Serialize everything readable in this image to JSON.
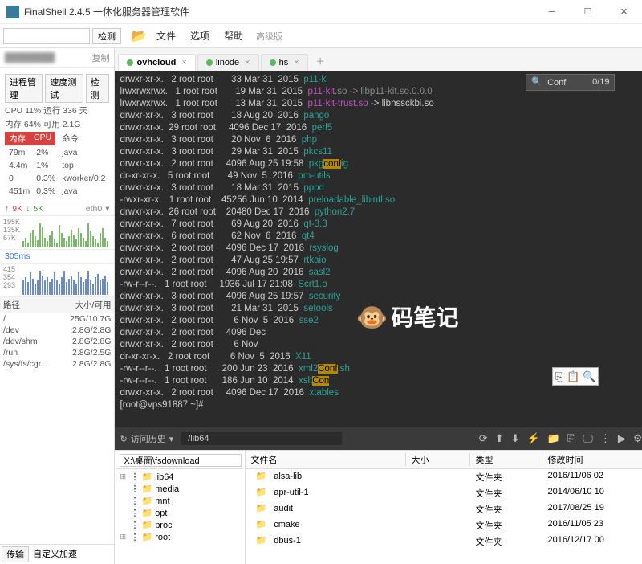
{
  "title": "FinalShell 2.4.5 一体化服务器管理软件",
  "topbar": {
    "search_placeholder": "",
    "detect": "检测",
    "menu_file": "文件",
    "menu_option": "选项",
    "menu_help": "帮助",
    "adv": "高级版"
  },
  "tabs": [
    {
      "name": "ovhcloud"
    },
    {
      "name": "linode"
    },
    {
      "name": "hs"
    }
  ],
  "sidebar": {
    "copy": "复制",
    "tabs": [
      "进程管理",
      "速度测试",
      "检测"
    ],
    "cpu_line": "CPU 11% 运行 336 天",
    "mem_line": "内存 64% 可用 2.1G",
    "col_mem": "内存",
    "col_cpu": "CPU",
    "col_cmd": "命令",
    "procs": [
      [
        "79m",
        "2%",
        "java"
      ],
      [
        "4.4m",
        "1%",
        "top"
      ],
      [
        "0",
        "0.3%",
        "kworker/0:2"
      ],
      [
        "451m",
        "0.3%",
        "java"
      ]
    ],
    "net_up": "9K",
    "net_down": "5K",
    "net_if": "eth0",
    "chart1_labels": [
      "195K",
      "135K",
      "67K"
    ],
    "ping": "305ms",
    "chart2_labels": [
      "415",
      "354",
      "293"
    ],
    "path_head": [
      "路径",
      "大小/可用"
    ],
    "paths": [
      [
        "/",
        "25G/10.7G"
      ],
      [
        "/dev",
        "2.8G/2.8G"
      ],
      [
        "/dev/shm",
        "2.8G/2.8G"
      ],
      [
        "/run",
        "2.8G/2.5G"
      ],
      [
        "/sys/fs/cgr...",
        "2.8G/2.8G"
      ]
    ],
    "bottom_tabs": [
      "传输",
      "自定义加速"
    ]
  },
  "find": {
    "text": "Conf",
    "count": "0/19"
  },
  "term_lines": [
    {
      "perm": "drwxr-xr-x.",
      "n": "2",
      "own": "root root",
      "size": "33",
      "date": "Mar 31  2015",
      "name": "p11-ki"
    },
    {
      "perm": "lrwxrwxrwx.",
      "n": "1",
      "own": "root root",
      "size": "19",
      "date": "Mar 31  2015",
      "name": "p11-kit",
      "extra": ".so -> libp11-kit.so.0.0.0"
    },
    {
      "perm": "lrwxrwxrwx.",
      "n": "1",
      "own": "root root",
      "size": "13",
      "date": "Mar 31  2015",
      "name": "p11-kit-trust.so",
      "link": " -> libnssckbi.so"
    },
    {
      "perm": "drwxr-xr-x.",
      "n": "3",
      "own": "root root",
      "size": "18",
      "date": "Aug 20  2016",
      "name": "pango"
    },
    {
      "perm": "drwxr-xr-x.",
      "n": "29",
      "own": "root root",
      "size": "4096",
      "date": "Dec 17  2016",
      "name": "perl5"
    },
    {
      "perm": "drwxr-xr-x.",
      "n": "3",
      "own": "root root",
      "size": "20",
      "date": "Nov  6  2016",
      "name": "php"
    },
    {
      "perm": "drwxr-xr-x.",
      "n": "3",
      "own": "root root",
      "size": "29",
      "date": "Mar 31  2015",
      "name": "pkcs11"
    },
    {
      "perm": "drwxr-xr-x.",
      "n": "2",
      "own": "root root",
      "size": "4096",
      "date": "Aug 25 19:58",
      "name": "pkg",
      "hl": "conf",
      "suf": "ig"
    },
    {
      "perm": "dr-xr-xr-x.",
      "n": "5",
      "own": "root root",
      "size": "49",
      "date": "Nov  5  2016",
      "name": "pm-utils"
    },
    {
      "perm": "drwxr-xr-x.",
      "n": "3",
      "own": "root root",
      "size": "18",
      "date": "Mar 31  2015",
      "name": "pppd"
    },
    {
      "perm": "-rwxr-xr-x.",
      "n": "1",
      "own": "root root",
      "size": "45256",
      "date": "Jun 10  2014",
      "name": "preloadable_libintl.so"
    },
    {
      "perm": "drwxr-xr-x.",
      "n": "26",
      "own": "root root",
      "size": "20480",
      "date": "Dec 17  2016",
      "name": "python2.7"
    },
    {
      "perm": "drwxr-xr-x.",
      "n": "7",
      "own": "root root",
      "size": "69",
      "date": "Aug 20  2016",
      "name": "qt-3.3"
    },
    {
      "perm": "drwxr-xr-x.",
      "n": "6",
      "own": "root root",
      "size": "62",
      "date": "Nov  6  2016",
      "name": "qt4"
    },
    {
      "perm": "drwxr-xr-x.",
      "n": "2",
      "own": "root root",
      "size": "4096",
      "date": "Dec 17  2016",
      "name": "rsyslog"
    },
    {
      "perm": "drwxr-xr-x.",
      "n": "2",
      "own": "root root",
      "size": "47",
      "date": "Aug 25 19:57",
      "name": "rtkaio"
    },
    {
      "perm": "drwxr-xr-x.",
      "n": "2",
      "own": "root root",
      "size": "4096",
      "date": "Aug 20  2016",
      "name": "sasl2"
    },
    {
      "perm": "-rw-r--r--.",
      "n": "1",
      "own": "root root",
      "size": "1936",
      "date": "Jul 17 21:08",
      "name": "Scrt1.o"
    },
    {
      "perm": "drwxr-xr-x.",
      "n": "3",
      "own": "root root",
      "size": "4096",
      "date": "Aug 25 19:57",
      "name": "security"
    },
    {
      "perm": "drwxr-xr-x.",
      "n": "3",
      "own": "root root",
      "size": "21",
      "date": "Mar 31  2015",
      "name": "setools"
    },
    {
      "perm": "drwxr-xr-x.",
      "n": "2",
      "own": "root root",
      "size": "6",
      "date": "Nov  5  2016",
      "name": "sse2"
    },
    {
      "perm": "drwxr-xr-x.",
      "n": "2",
      "own": "root root",
      "size": "4096",
      "date": "Dec",
      "name": ""
    },
    {
      "perm": "drwxr-xr-x.",
      "n": "2",
      "own": "root root",
      "size": "6",
      "date": "Nov",
      "name": ""
    },
    {
      "perm": "dr-xr-xr-x.",
      "n": "2",
      "own": "root root",
      "size": "6",
      "date": "Nov  5  2016",
      "name": "X11"
    },
    {
      "perm": "-rw-r--r--.",
      "n": "1",
      "own": "root root",
      "size": "200",
      "date": "Jun 23  2016",
      "name": "xml2",
      "hl": "Conf",
      "suf": ".sh"
    },
    {
      "perm": "-rw-r--r--.",
      "n": "1",
      "own": "root root",
      "size": "186",
      "date": "Jun 10  2014",
      "name": "xslt",
      "hl": "Con"
    },
    {
      "perm": "drwxr-xr-x.",
      "n": "2",
      "own": "root root",
      "size": "4096",
      "date": "Dec 17  2016",
      "name": "xtables"
    }
  ],
  "prompt": "[root@vps91887 ~]# ",
  "watermark": "码笔记",
  "termbar": {
    "hist": "访问历史",
    "path": "/lib64"
  },
  "tree": {
    "pathlabel": "X:\\桌面\\fsdownload",
    "items": [
      "lib64",
      "media",
      "mnt",
      "opt",
      "proc",
      "root"
    ]
  },
  "filelist": {
    "headers": [
      "文件名",
      "大小",
      "类型",
      "修改时间"
    ],
    "rows": [
      [
        "alsa-lib",
        "",
        "文件夹",
        "2016/11/06 02"
      ],
      [
        "apr-util-1",
        "",
        "文件夹",
        "2014/06/10 10"
      ],
      [
        "audit",
        "",
        "文件夹",
        "2017/08/25 19"
      ],
      [
        "cmake",
        "",
        "文件夹",
        "2016/11/05 23"
      ],
      [
        "dbus-1",
        "",
        "文件夹",
        "2016/12/17 00"
      ]
    ]
  }
}
